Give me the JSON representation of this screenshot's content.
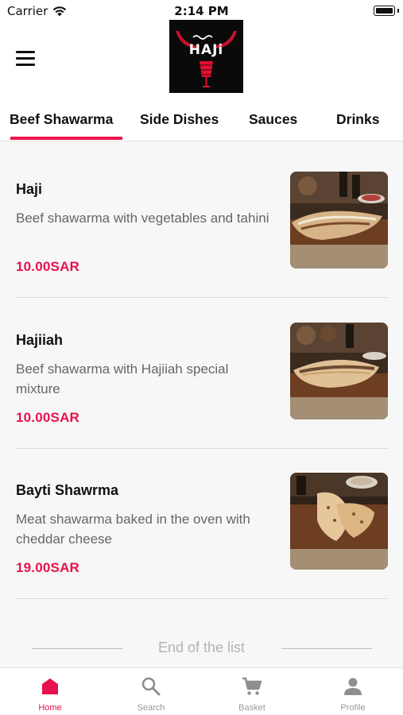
{
  "status_bar": {
    "carrier": "Carrier",
    "time": "2:14 PM"
  },
  "header": {
    "logo_text": "HAJi",
    "logo_subtext": "حجي"
  },
  "tabs": [
    {
      "label": "Beef Shawarma",
      "active": true
    },
    {
      "label": "Side Dishes",
      "active": false
    },
    {
      "label": "Sauces",
      "active": false
    },
    {
      "label": "Drinks",
      "active": false
    }
  ],
  "items": [
    {
      "name": "Haji",
      "description": "Beef shawarma with vegetables and tahini",
      "price": "10.00SAR"
    },
    {
      "name": "Hajiiah",
      "description": "Beef shawarma with Hajiiah special mixture",
      "price": "10.00SAR"
    },
    {
      "name": "Bayti Shawrma",
      "description": "Meat shawarma baked in the oven with cheddar cheese",
      "price": "19.00SAR"
    }
  ],
  "end_of_list": "End of the list",
  "bottom_nav": [
    {
      "label": "Home",
      "icon": "home-icon",
      "active": true
    },
    {
      "label": "Search",
      "icon": "search-icon",
      "active": false
    },
    {
      "label": "Basket",
      "icon": "cart-icon",
      "active": false
    },
    {
      "label": "Profile",
      "icon": "person-icon",
      "active": false
    }
  ],
  "colors": {
    "accent": "#e8114d",
    "tab_underline": "#f0154c"
  }
}
